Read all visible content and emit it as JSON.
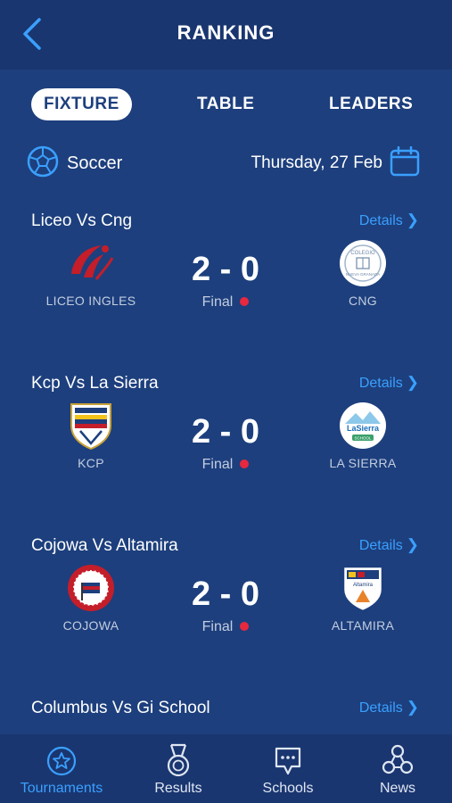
{
  "header": {
    "title": "RANKING",
    "back_icon": "chevron-left-icon"
  },
  "tabs": [
    {
      "label": "FIXTURE",
      "active": true
    },
    {
      "label": "TABLE",
      "active": false
    },
    {
      "label": "LEADERS",
      "active": false
    }
  ],
  "filter": {
    "sport": "Soccer",
    "sport_icon": "soccer-ball-icon",
    "date": "Thursday, 27 Feb",
    "date_icon": "calendar-icon"
  },
  "details_label": "Details",
  "matches": [
    {
      "title": "Liceo Vs Cng",
      "home": "LICEO INGLES",
      "away": "CNG",
      "score": "2 - 0",
      "status": "Final"
    },
    {
      "title": "Kcp Vs La Sierra",
      "home": "KCP",
      "away": "LA SIERRA",
      "score": "2 - 0",
      "status": "Final"
    },
    {
      "title": "Cojowa Vs Altamira",
      "home": "COJOWA",
      "away": "ALTAMIRA",
      "score": "2 - 0",
      "status": "Final"
    },
    {
      "title": "Columbus Vs Gi School"
    }
  ],
  "logo_text": {
    "cng_top": "COLEGIO",
    "cng_bottom": "NUEVA GRANADA",
    "lasierra_top": "LaSierra",
    "lasierra_bottom": "SCHOOL",
    "altamira": "Altamira"
  },
  "bottom_nav": [
    {
      "label": "Tournaments",
      "icon": "star-circle-icon",
      "active": true
    },
    {
      "label": "Results",
      "icon": "medal-icon",
      "active": false
    },
    {
      "label": "Schools",
      "icon": "chat-shield-icon",
      "active": false
    },
    {
      "label": "News",
      "icon": "share-network-icon",
      "active": false
    }
  ],
  "colors": {
    "background": "#1d3f7d",
    "header": "#1a3670",
    "accent": "#3aa0ff",
    "live_dot": "#e8283f"
  }
}
